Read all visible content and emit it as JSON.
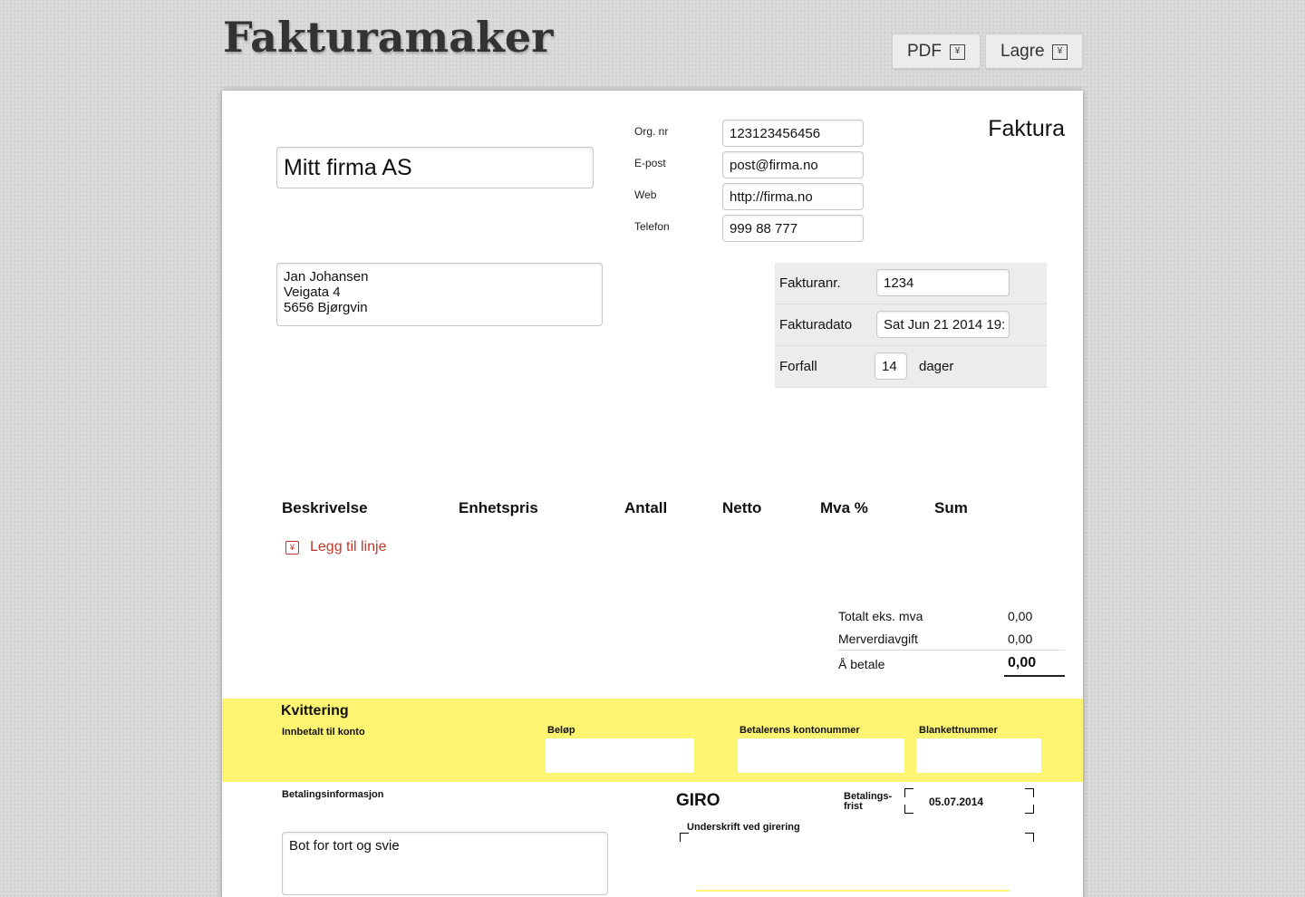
{
  "app": {
    "title": "Fakturamaker"
  },
  "toolbar": {
    "pdf_label": "PDF",
    "save_label": "Lagre"
  },
  "sender": {
    "company": "Mitt firma AS",
    "org_label": "Org. nr",
    "org_value": "123123456456",
    "email_label": "E-post",
    "email_value": "post@firma.no",
    "web_label": "Web",
    "web_value": "http://firma.no",
    "phone_label": "Telefon",
    "phone_value": "999 88 777"
  },
  "document": {
    "type": "Faktura"
  },
  "recipient": {
    "address": "Jan Johansen\nVeigata 4\n5656 Bjørgvin"
  },
  "meta": {
    "invoice_no_label": "Fakturanr.",
    "invoice_no": "1234",
    "date_label": "Fakturadato",
    "date": "Sat Jun 21 2014 19:",
    "due_label": "Forfall",
    "due_days": "14",
    "due_unit": "dager"
  },
  "table": {
    "headers": [
      "Beskrivelse",
      "Enhetspris",
      "Antall",
      "Netto",
      "Mva %",
      "Sum"
    ],
    "add_line_label": "Legg til linje"
  },
  "totals": {
    "net_label": "Totalt eks. mva",
    "net": "0,00",
    "vat_label": "Merverdiavgift",
    "vat": "0,00",
    "pay_label": "Å betale",
    "pay": "0,00"
  },
  "receipt": {
    "title": "Kvittering",
    "account_label": "Innbetalt til konto",
    "amount_label": "Beløp",
    "payer_account_label": "Betalerens kontonummer",
    "form_no_label": "Blankettnummer"
  },
  "giro": {
    "payment_info_label": "Betalingsinformasjon",
    "payment_info": "Bot for tort og svie",
    "title": "GIRO",
    "deadline_label": "Betalings-\nfrist",
    "deadline": "05.07.2014",
    "signature_label": "Underskrift ved girering"
  },
  "colors": {
    "receipt_bg": "#fdf571",
    "add_line": "#c0392b",
    "meta_bg": "#ececec"
  },
  "icons": {
    "pdf": "pdf-download-icon",
    "save": "save-icon",
    "add": "add-line-icon"
  }
}
